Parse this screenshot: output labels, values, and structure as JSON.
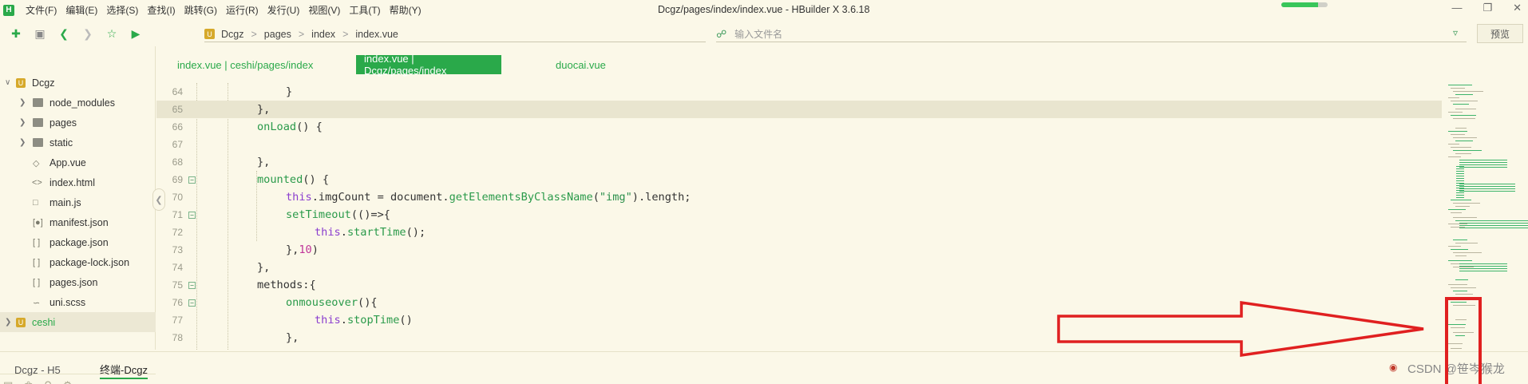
{
  "app": {
    "logo_text": "H",
    "window_title": "Dcgz/pages/index/index.vue - HBuilder X 3.6.18",
    "menu": [
      "文件(F)",
      "编辑(E)",
      "选择(S)",
      "查找(I)",
      "跳转(G)",
      "运行(R)",
      "发行(U)",
      "视图(V)",
      "工具(T)",
      "帮助(Y)"
    ],
    "progress_fraction": 0.8,
    "window_buttons": [
      "minimize",
      "restore",
      "close"
    ]
  },
  "toolbar": {
    "icons": [
      "new-file-icon",
      "save-icon",
      "back-icon",
      "forward-icon",
      "star-icon",
      "run-icon"
    ],
    "breadcrumb": [
      "Dcgz",
      "pages",
      "index",
      "index.vue"
    ],
    "file_search_placeholder": "输入文件名",
    "preview_label": "预览"
  },
  "sidebar": {
    "items": [
      {
        "label": "Dcgz",
        "kind": "project",
        "expanded": true,
        "depth": 0
      },
      {
        "label": "node_modules",
        "kind": "folder",
        "depth": 1
      },
      {
        "label": "pages",
        "kind": "folder",
        "depth": 1
      },
      {
        "label": "static",
        "kind": "folder",
        "depth": 1
      },
      {
        "label": "App.vue",
        "kind": "vue",
        "depth": 1
      },
      {
        "label": "index.html",
        "kind": "html",
        "depth": 1
      },
      {
        "label": "main.js",
        "kind": "js",
        "depth": 1
      },
      {
        "label": "manifest.json",
        "kind": "manifest",
        "depth": 1
      },
      {
        "label": "package.json",
        "kind": "json",
        "depth": 1
      },
      {
        "label": "package-lock.json",
        "kind": "json",
        "depth": 1
      },
      {
        "label": "pages.json",
        "kind": "json",
        "depth": 1
      },
      {
        "label": "uni.scss",
        "kind": "scss",
        "depth": 1
      },
      {
        "label": "ceshi",
        "kind": "project",
        "expanded": false,
        "depth": 0
      }
    ]
  },
  "tabs": [
    {
      "label": "index.vue | ceshi/pages/index",
      "active": false
    },
    {
      "label": "index.vue | Dcgz/pages/index",
      "active": true
    },
    {
      "label": "duocai.vue",
      "active": false
    }
  ],
  "code": {
    "lines": [
      {
        "n": "64",
        "text": "            }"
      },
      {
        "n": "65",
        "text": "        },"
      },
      {
        "n": "66",
        "text": "        onLoad() {"
      },
      {
        "n": "67",
        "text": ""
      },
      {
        "n": "68",
        "text": "        },"
      },
      {
        "n": "69",
        "text": "        mounted() {"
      },
      {
        "n": "70",
        "text": "            this.imgCount = document.getElementsByClassName(\"img\").length;"
      },
      {
        "n": "71",
        "text": "            setTimeout(()=>{"
      },
      {
        "n": "72",
        "text": "                this.startTime();"
      },
      {
        "n": "73",
        "text": "            },10)"
      },
      {
        "n": "74",
        "text": "        },"
      },
      {
        "n": "75",
        "text": "        methods:{"
      },
      {
        "n": "76",
        "text": "            onmouseover(){"
      },
      {
        "n": "77",
        "text": "                this.stopTime()"
      },
      {
        "n": "78",
        "text": "            },"
      }
    ]
  },
  "bottom": {
    "tabs": [
      {
        "label": "Dcgz - H5",
        "active": false
      },
      {
        "label": "终端-Dcgz",
        "active": true
      }
    ],
    "watermark": "CSDN @笹岑猴龙"
  },
  "colors": {
    "accent": "#2aa94a",
    "background": "#fbf8e8",
    "annotation": "#e02020"
  }
}
